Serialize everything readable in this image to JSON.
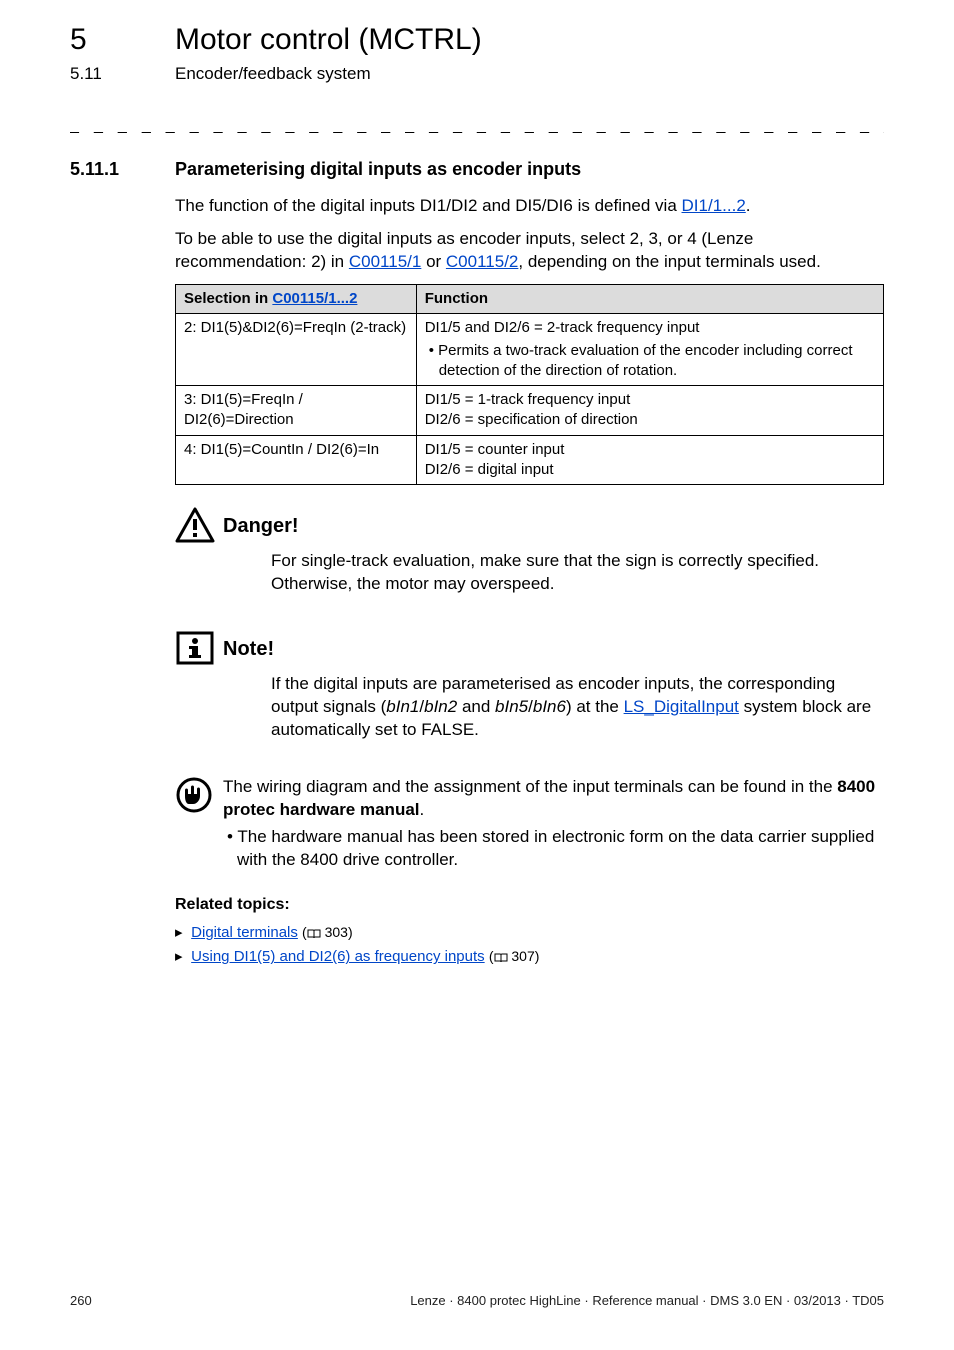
{
  "header": {
    "chapter_number": "5",
    "chapter_title": "Motor control (MCTRL)",
    "subsection_number": "5.11",
    "subsection_title": "Encoder/feedback system"
  },
  "section": {
    "number": "5.11.1",
    "title": "Parameterising digital inputs as encoder inputs"
  },
  "intro": {
    "p1_a": "The function of the digital inputs DI1/DI2 and DI5/DI6 is defined via ",
    "p1_link": "DI1/1...2",
    "p1_b": ".",
    "p2_a": "To be able to use the digital inputs as encoder inputs, select 2, 3, or 4 (Lenze recommendation: 2) in ",
    "p2_link1": "C00115/1",
    "p2_or": " or ",
    "p2_link2": "C00115/2",
    "p2_b": ", depending on the input terminals used."
  },
  "table": {
    "head_sel_a": "Selection in ",
    "head_sel_link": "C00115/1...2",
    "head_func": "Function",
    "rows": [
      {
        "sel": "2: DI1(5)&DI2(6)=FreqIn (2-track)",
        "func_line1": "DI1/5 and DI2/6 = 2-track frequency input",
        "func_bullet": "• Permits a two-track evaluation of the encoder including correct detection of the direction of rotation."
      },
      {
        "sel": "3: DI1(5)=FreqIn / DI2(6)=Direction",
        "func_line1": "DI1/5 = 1-track frequency input",
        "func_line2": "DI2/6 = specification of direction"
      },
      {
        "sel": "4: DI1(5)=CountIn / DI2(6)=In",
        "func_line1": "DI1/5 = counter input",
        "func_line2": "DI2/6 = digital input"
      }
    ]
  },
  "danger": {
    "title": "Danger!",
    "text": "For single-track evaluation, make sure that the sign is correctly specified. Otherwise, the motor may overspeed."
  },
  "note": {
    "title": "Note!",
    "t1": "If the digital inputs are parameterised as encoder inputs, the corresponding output signals (",
    "i1": "bIn1",
    "sep1": "/",
    "i2": "bIn2",
    "and": " and ",
    "i3": "bIn5",
    "sep2": "/",
    "i4": "bIn6",
    "t2": ") at the ",
    "link": "LS_DigitalInput",
    "t3": " system block are automatically set to FALSE."
  },
  "hand": {
    "t1": "The wiring diagram and the assignment of the input terminals can be found in the ",
    "bold": "8400 protec hardware manual",
    "t2": ".",
    "bullet": "The hardware manual has been stored in electronic form on the data carrier supplied with the 8400 drive controller."
  },
  "related": {
    "title": "Related topics:",
    "items": [
      {
        "link": "Digital terminals",
        "page": "303"
      },
      {
        "link": "Using DI1(5) and DI2(6) as frequency inputs",
        "page": "307"
      }
    ]
  },
  "footer": {
    "page": "260",
    "info": "Lenze · 8400 protec HighLine · Reference manual · DMS 3.0 EN · 03/2013 · TD05"
  },
  "chart_data": {
    "type": "table",
    "title": "Selection in C00115/1...2 — function mapping",
    "columns": [
      "Selection",
      "Function"
    ],
    "rows": [
      [
        "2: DI1(5)&DI2(6)=FreqIn (2-track)",
        "DI1/5 and DI2/6 = 2-track frequency input; permits two-track evaluation of the encoder including correct detection of the direction of rotation."
      ],
      [
        "3: DI1(5)=FreqIn / DI2(6)=Direction",
        "DI1/5 = 1-track frequency input; DI2/6 = specification of direction"
      ],
      [
        "4: DI1(5)=CountIn / DI2(6)=In",
        "DI1/5 = counter input; DI2/6 = digital input"
      ]
    ]
  }
}
